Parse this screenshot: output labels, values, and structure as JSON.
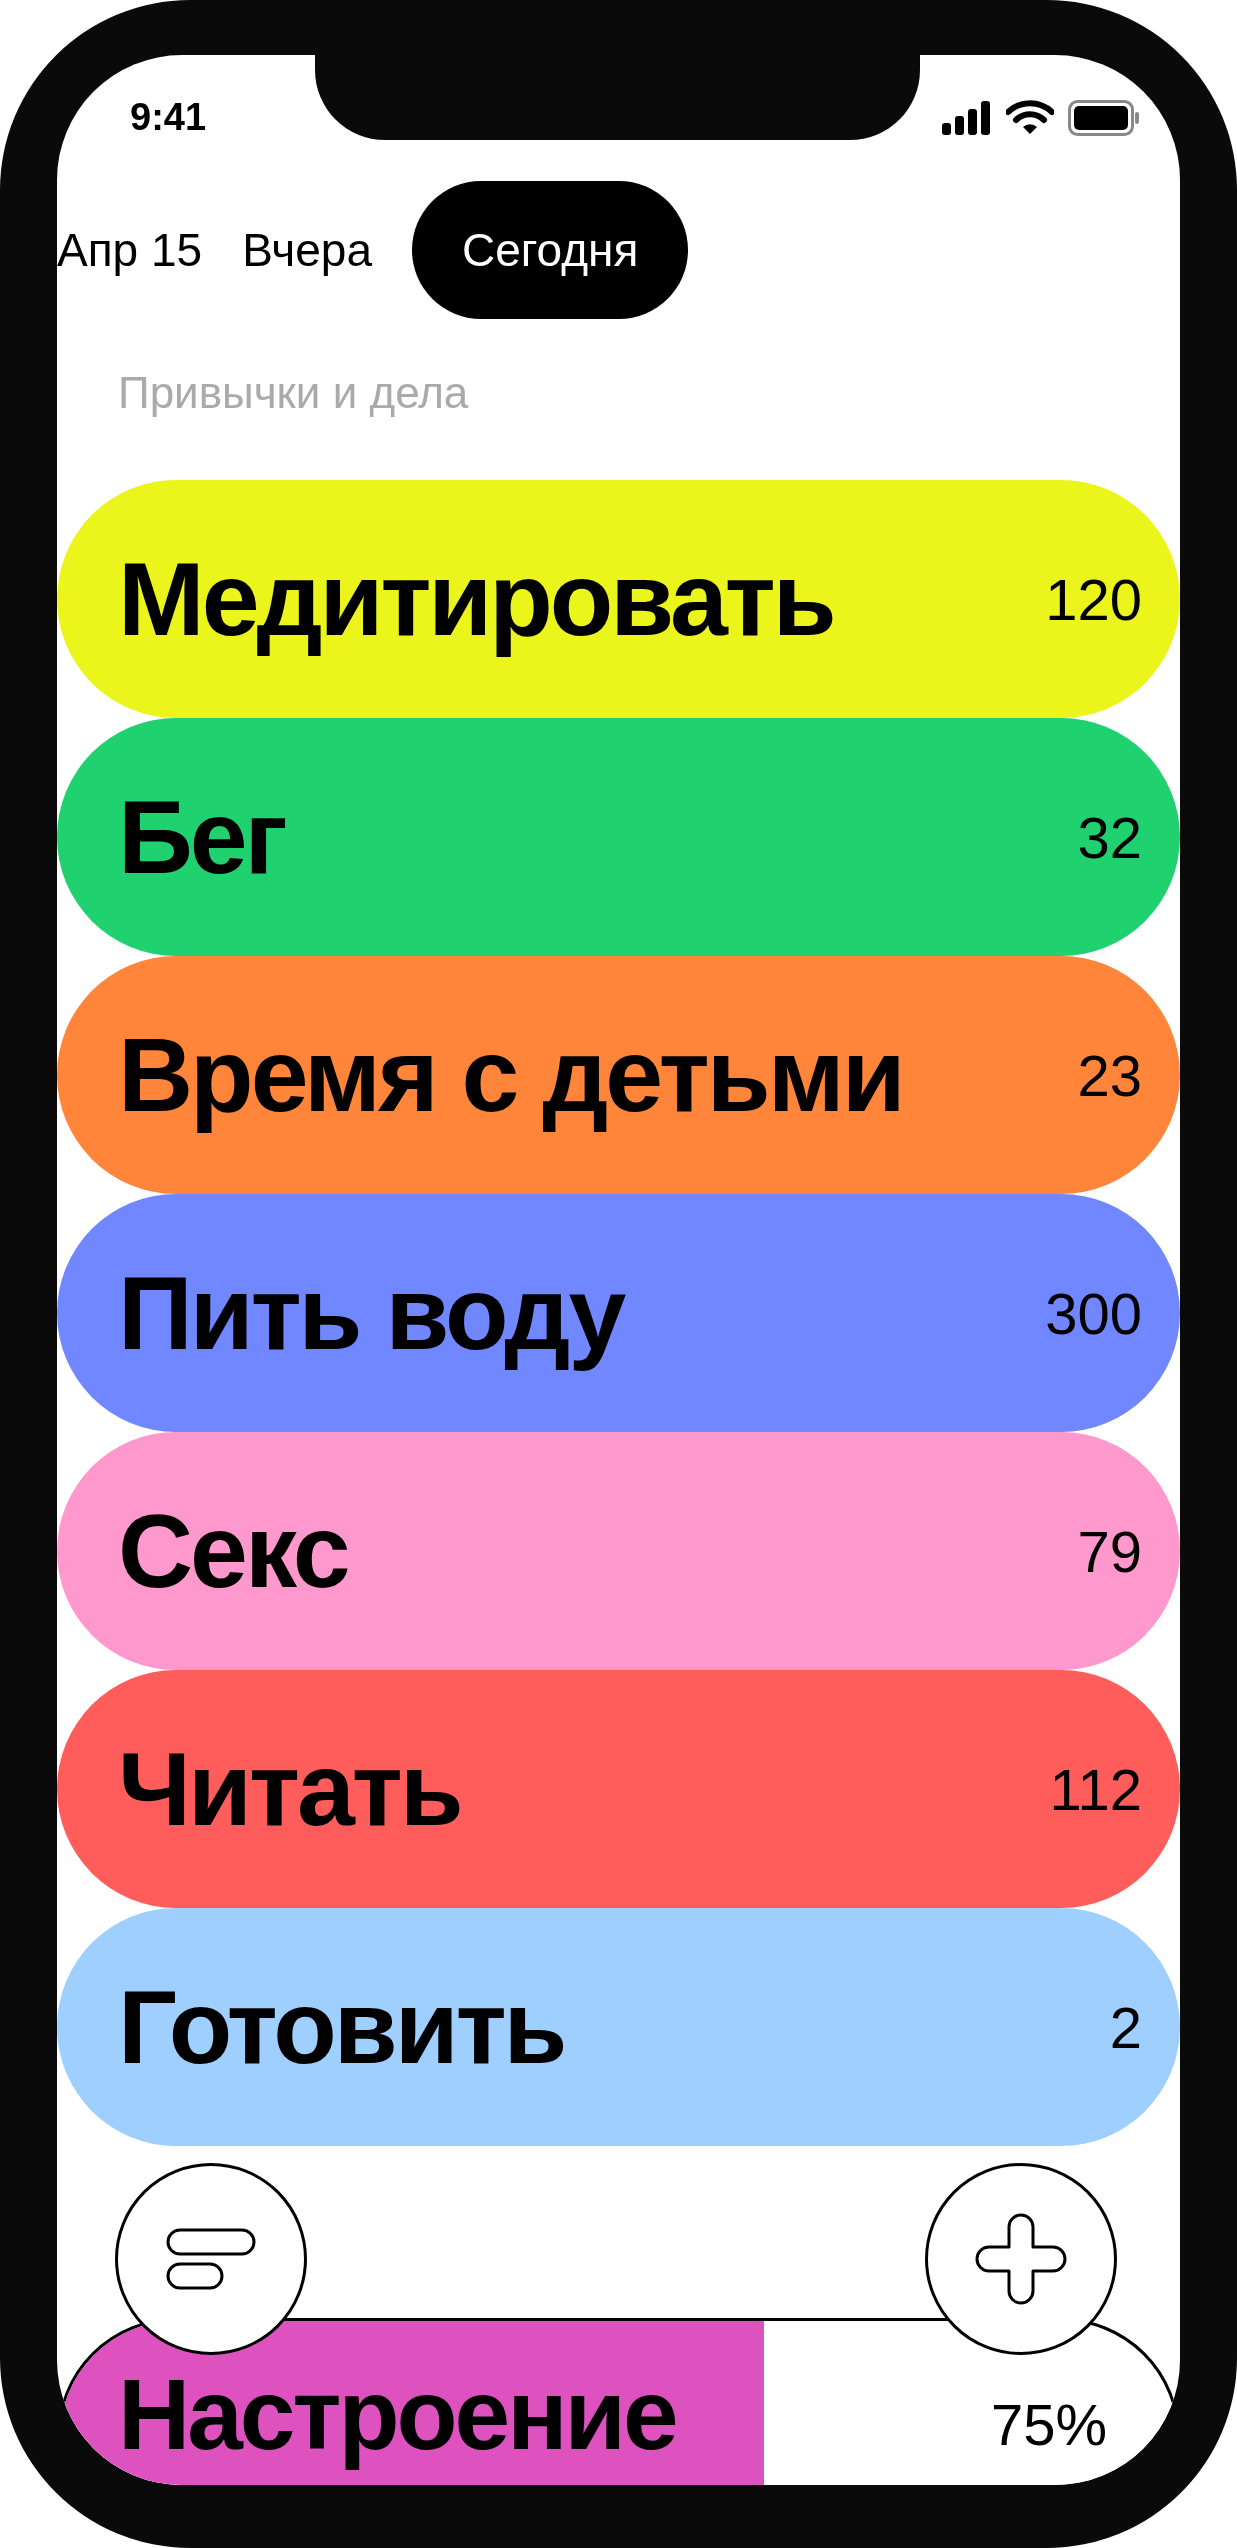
{
  "status_bar": {
    "time": "9:41"
  },
  "tabs": [
    {
      "label": "Апр 15",
      "selected": false
    },
    {
      "label": "Вчера",
      "selected": false
    },
    {
      "label": "Сегодня",
      "selected": true
    }
  ],
  "section_title": "Привычки и дела",
  "habits": [
    {
      "name": "Медитировать",
      "count": "120",
      "color": "#ebf51b"
    },
    {
      "name": "Бег",
      "count": "32",
      "color": "#20d16f"
    },
    {
      "name": "Время с детьми",
      "count": "23",
      "color": "#ff853a"
    },
    {
      "name": "Пить воду",
      "count": "300",
      "color": "#7087ff"
    },
    {
      "name": "Секс",
      "count": "79",
      "color": "#ff98cc"
    },
    {
      "name": "Читать",
      "count": "112",
      "color": "#ff5c5c"
    },
    {
      "name": "Готовить",
      "count": "2",
      "color": "#9ecfff"
    }
  ],
  "mood": {
    "name": "Настроение",
    "value": "75%",
    "level": 0.63,
    "color": "#de52c0"
  }
}
